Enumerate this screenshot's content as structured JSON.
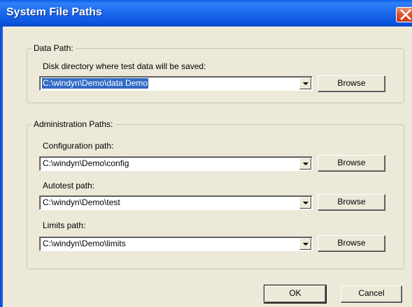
{
  "window": {
    "title": "System File Paths"
  },
  "data_path": {
    "group_label": "Data Path:",
    "description": "Disk directory where test data will be saved:",
    "value": "C:\\windyn\\Demo\\data Demo",
    "browse_label": "Browse"
  },
  "admin_paths": {
    "group_label": "Administration Paths:",
    "configuration": {
      "label": "Configuration path:",
      "value": "C:\\windyn\\Demo\\config",
      "browse_label": "Browse"
    },
    "autotest": {
      "label": "Autotest path:",
      "value": "C:\\windyn\\Demo\\test",
      "browse_label": "Browse"
    },
    "limits": {
      "label": "Limits path:",
      "value": "C:\\windyn\\Demo\\limits",
      "browse_label": "Browse"
    }
  },
  "footer": {
    "ok_label": "OK",
    "cancel_label": "Cancel"
  },
  "colors": {
    "titlebar": "#0a55dc",
    "dialog_bg": "#ece9d8",
    "selection": "#316ac5"
  },
  "icons": {
    "close": "close-icon",
    "dropdown": "chevron-down-icon"
  }
}
